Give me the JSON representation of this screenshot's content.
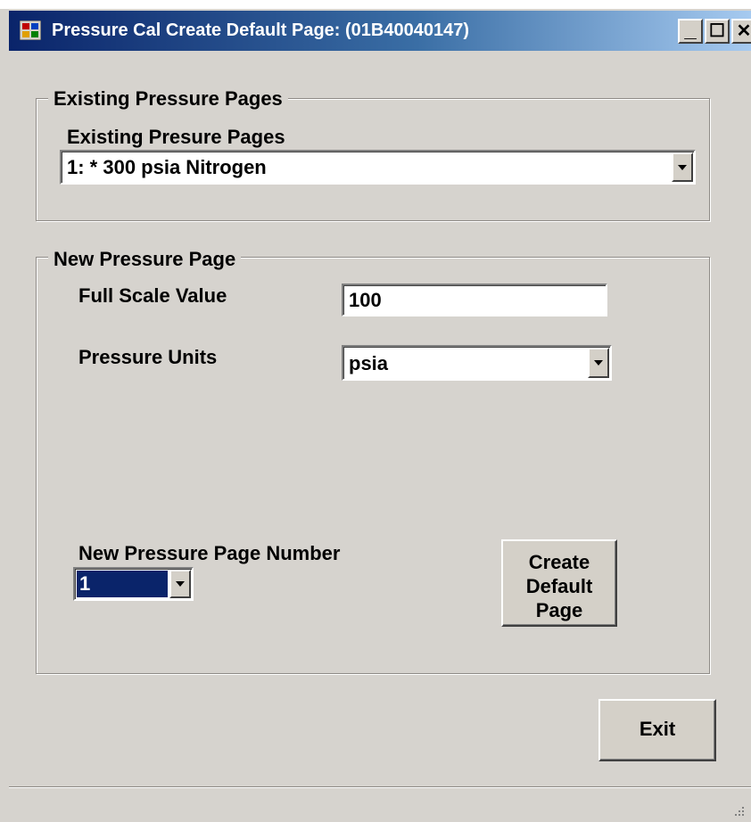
{
  "window": {
    "title": "Pressure Cal Create Default Page: (01B40040147)",
    "title_bar_color": "#0a246a",
    "buttons": {
      "minimize": "_",
      "maximize": "☐",
      "close": "✕"
    }
  },
  "existing_group": {
    "legend": "Existing Pressure Pages",
    "combo_label": "Existing Presure Pages",
    "combo_value": "1: * 300 psia Nitrogen"
  },
  "new_group": {
    "legend": "New Pressure Page",
    "full_scale_label": "Full Scale Value",
    "full_scale_value": "100",
    "units_label": "Pressure Units",
    "units_value": "psia",
    "page_number_label": "New Pressure Page Number",
    "page_number_value": "1",
    "create_button_line1": "Create",
    "create_button_line2": "Default",
    "create_button_line3": "Page"
  },
  "exit_button": "Exit",
  "colors": {
    "face": "#d6d3ce",
    "selection": "#0a246a"
  }
}
